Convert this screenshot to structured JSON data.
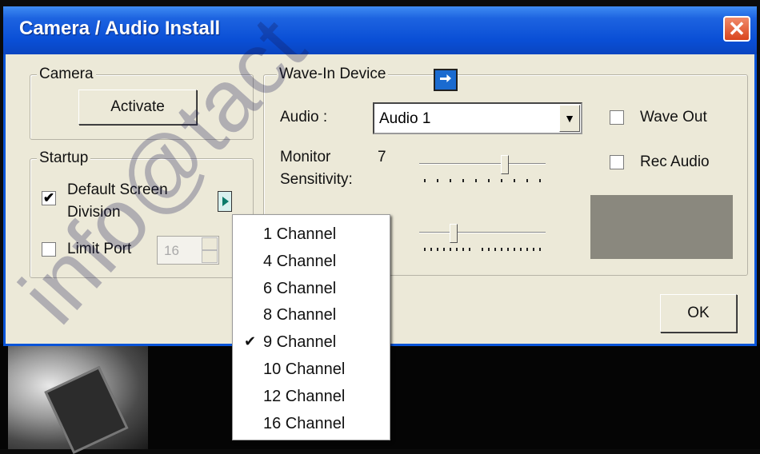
{
  "window": {
    "title": "Camera / Audio Install",
    "close_glyph": "✕"
  },
  "camera": {
    "group_label": "Camera",
    "activate_label": "Activate"
  },
  "startup": {
    "group_label": "Startup",
    "default_screen_line1": "Default Screen",
    "default_screen_line2": "Division",
    "default_screen_checked": true,
    "limit_port_label": "Limit Port",
    "limit_port_checked": false,
    "limit_port_value": "16"
  },
  "wave_in": {
    "group_label": "Wave-In Device",
    "audio_label": "Audio :",
    "audio_value": "Audio 1",
    "wave_out_label": "Wave Out",
    "rec_audio_label": "Rec Audio",
    "monitor_label_line1": "Monitor",
    "monitor_label_line2": "Sensitivity:",
    "monitor_value": "7"
  },
  "ok_label": "OK",
  "menu": {
    "items": [
      {
        "label": "1 Channel",
        "checked": false
      },
      {
        "label": "4 Channel",
        "checked": false
      },
      {
        "label": "6 Channel",
        "checked": false
      },
      {
        "label": "8 Channel",
        "checked": false
      },
      {
        "label": "9 Channel",
        "checked": true
      },
      {
        "label": "10 Channel",
        "checked": false
      },
      {
        "label": "12 Channel",
        "checked": false
      },
      {
        "label": "16 Channel",
        "checked": false
      }
    ],
    "check_glyph": "✔"
  },
  "watermark": "info@tact"
}
